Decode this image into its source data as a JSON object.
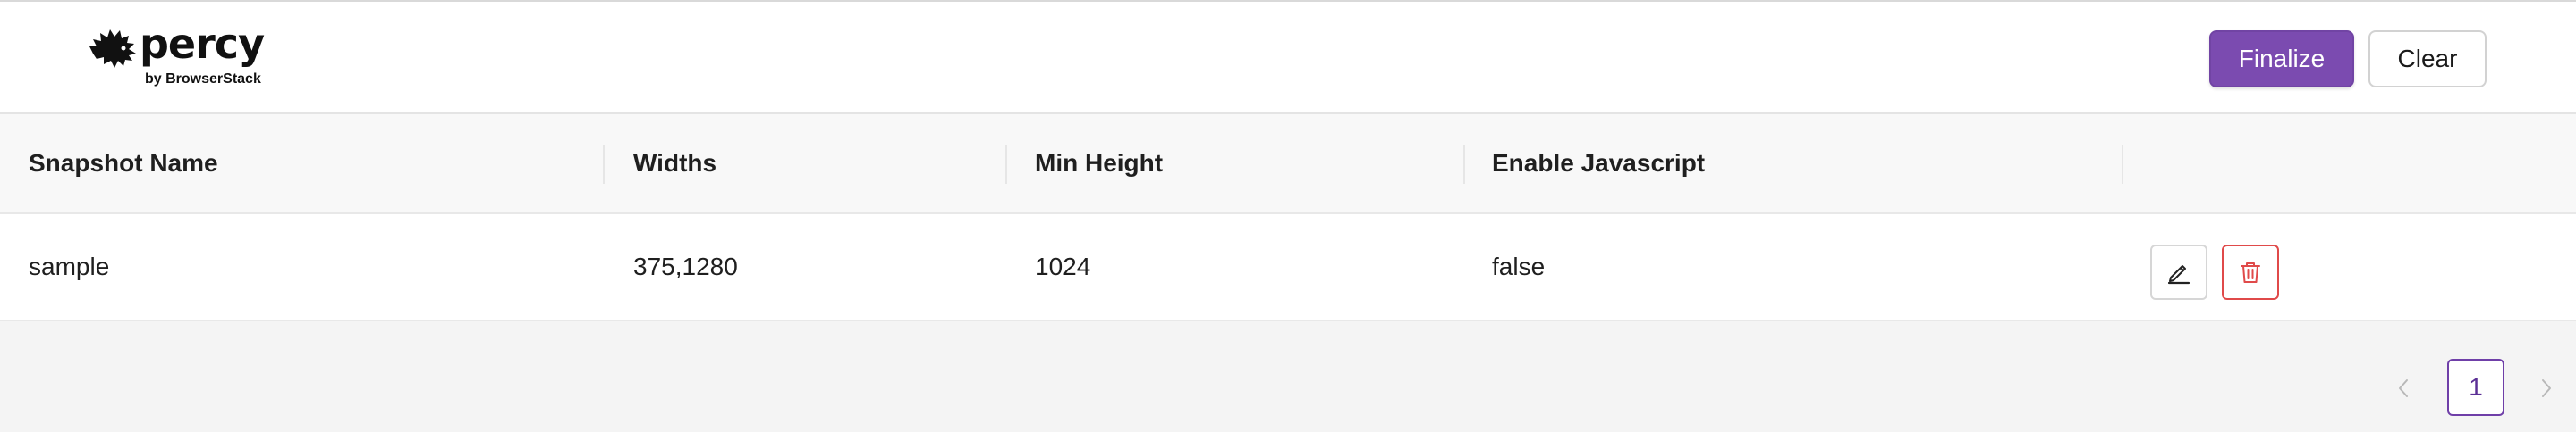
{
  "brand": {
    "name": "percy",
    "tagline": "by BrowserStack",
    "logo_icon": "hedgehog-logo-icon"
  },
  "toolbar": {
    "finalize_label": "Finalize",
    "clear_label": "Clear"
  },
  "colors": {
    "accent": "#7b4bb0",
    "danger": "#e04a4a",
    "header_bg": "#f8f8f8",
    "page_bg": "#f4f4f4"
  },
  "table": {
    "columns": [
      "Snapshot Name",
      "Widths",
      "Min Height",
      "Enable Javascript",
      ""
    ],
    "rows": [
      {
        "snapshot_name": "sample",
        "widths": "375,1280",
        "min_height": "1024",
        "enable_javascript": "false",
        "actions": [
          "pencil-edit-icon",
          "trash-delete-icon"
        ]
      }
    ]
  },
  "pagination": {
    "current_page": "1",
    "prev_icon": "chevron-left-icon",
    "next_icon": "chevron-right-icon"
  }
}
